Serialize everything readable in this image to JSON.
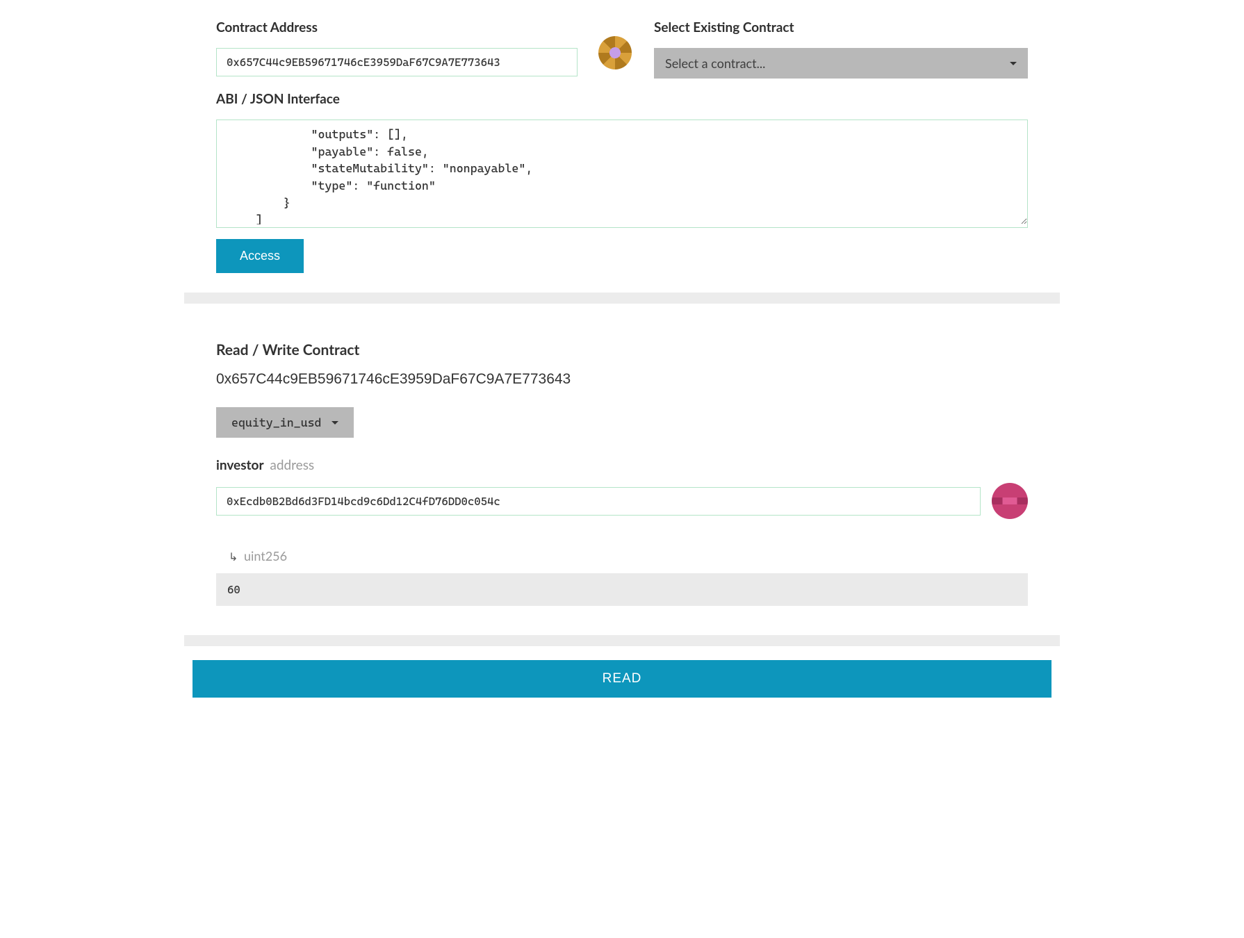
{
  "form": {
    "contract_address_label": "Contract Address",
    "contract_address_value": "0x657C44c9EB59671746cE3959DaF67C9A7E773643",
    "select_existing_label": "Select Existing Contract",
    "select_placeholder": "Select a contract...",
    "abi_label": "ABI / JSON Interface",
    "abi_value": "            \"outputs\": [],\n            \"payable\": false,\n            \"stateMutability\": \"nonpayable\",\n            \"type\": \"function\"\n        }\n    ]",
    "access_button": "Access"
  },
  "interact": {
    "heading": "Read / Write Contract",
    "address": "0x657C44c9EB59671746cE3959DaF67C9A7E773643",
    "selected_function": "equity_in_usd",
    "param": {
      "name": "investor",
      "type": "address",
      "value": "0xEcdb0B2Bd6d3FD14bcd9c6Dd12C4fD76DD0c054c"
    },
    "result": {
      "type": "uint256",
      "value": "60"
    },
    "read_button": "READ"
  }
}
